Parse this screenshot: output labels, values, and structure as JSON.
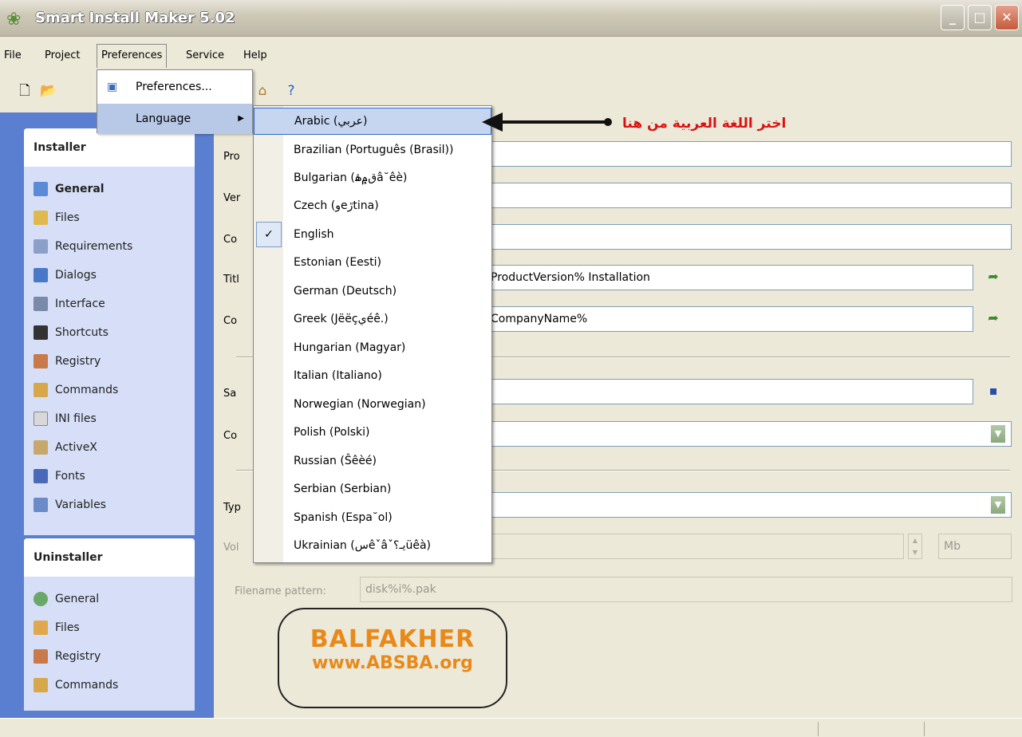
{
  "window": {
    "title": "Smart Install Maker 5.02"
  },
  "menubar": [
    "File",
    "Project",
    "Preferences",
    "Service",
    "Help"
  ],
  "preferences_menu": {
    "items": [
      "Preferences...",
      "Language"
    ]
  },
  "language_menu": {
    "items": [
      "Arabic (عربي)",
      "Brazilian (Português (Brasil))",
      "Bulgarian (ق۾ۿâ˘êè)",
      "Czech (ﻭeڙtina)",
      "English",
      "Estonian (Eesti)",
      "German (Deutsch)",
      "Greek (Jëëçيéê.)",
      "Hungarian (Magyar)",
      "Italian (Italiano)",
      "Norwegian (Norwegian)",
      "Polish (Polski)",
      "Russian (Ŝêèé)",
      "Serbian (Serbian)",
      "Spanish (Espa˘ol)",
      "Ukrainian (ﺱêˇâˇيـ؟üêà)"
    ],
    "checked": "English",
    "highlighted": "Arabic (عربي)"
  },
  "annotation": {
    "arabic_text": "اختر  اللغة العربية من هنا"
  },
  "sidebar": {
    "installer": {
      "title": "Installer",
      "items": [
        "General",
        "Files",
        "Requirements",
        "Dialogs",
        "Interface",
        "Shortcuts",
        "Registry",
        "Commands",
        "INI files",
        "ActiveX",
        "Fonts",
        "Variables"
      ]
    },
    "uninstaller": {
      "title": "Uninstaller",
      "items": [
        "General",
        "Files",
        "Registry",
        "Commands"
      ]
    }
  },
  "form": {
    "labels": [
      "Pro",
      "Ver",
      "Co",
      "Titl",
      "Co",
      "Sa",
      "Co",
      "Typ",
      "Vol"
    ],
    "title_value": "ProductVersion% Installation",
    "company_value": "CompanyName%",
    "volume_unit": "Mb",
    "filename_pattern_label": "Filename pattern:",
    "filename_pattern_value": "disk%i%.pak"
  },
  "watermark": {
    "line1": "BALFAKHER",
    "line2": "www.ABSBA.org"
  },
  "colors": {
    "sidebar_bg": "#5a7fd0",
    "highlight": "#c6d5f0",
    "annotation": "#dd1111",
    "watermark": "#e8891a"
  }
}
